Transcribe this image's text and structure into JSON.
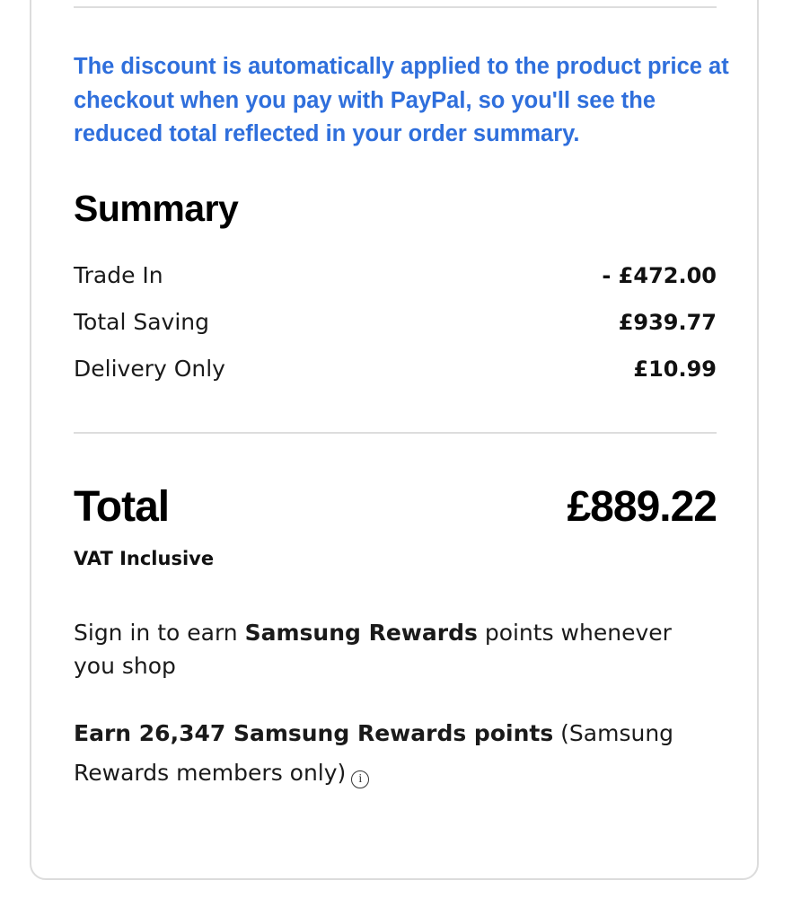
{
  "notice": {
    "text": "The discount is automatically applied to the product price at checkout when you pay with PayPal, so you'll see the reduced total reflected in your order summary."
  },
  "summary": {
    "title": "Summary",
    "rows": [
      {
        "label": "Trade In",
        "value": "- £472.00"
      },
      {
        "label": "Total Saving",
        "value": "£939.77"
      },
      {
        "label": "Delivery Only",
        "value": "£10.99"
      }
    ]
  },
  "total": {
    "label": "Total",
    "value": "£889.22",
    "vat_note": "VAT Inclusive"
  },
  "rewards": {
    "signin_prefix": "Sign in to earn ",
    "signin_bold": "Samsung Rewards",
    "signin_suffix": " points whenever you shop",
    "earn_bold": "Earn 26,347 Samsung Rewards points",
    "earn_suffix": " (Samsung Rewards members only)",
    "info_icon": "info-icon",
    "info_glyph": "i"
  },
  "colors": {
    "accent": "#2f6fdc",
    "divider": "#dddddd",
    "card_border": "#dcdcdc"
  }
}
